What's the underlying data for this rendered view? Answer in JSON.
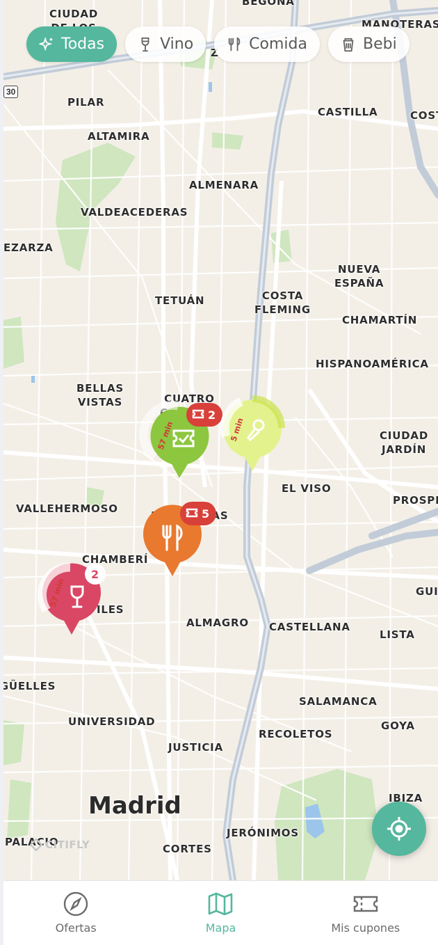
{
  "filters": [
    {
      "label": "Todas",
      "icon": "sparkles-icon",
      "active": true
    },
    {
      "label": "Vino",
      "icon": "wine-glass-icon",
      "active": false
    },
    {
      "label": "Comida",
      "icon": "fork-knife-icon",
      "active": false
    },
    {
      "label": "Bebi",
      "icon": "cup-icon",
      "active": false
    }
  ],
  "map": {
    "city": "Madrid",
    "road_shield": "30",
    "watermark": "CITIFLY",
    "places": [
      "CIUDAD\nDE LOS",
      "BEGOÑA",
      "MANOTERAS",
      "PILAR",
      "CASTILLA",
      "COST",
      "ALTAMIRA",
      "ALMENARA",
      "VALDEACEDERAS",
      "EZARZA",
      "NUEVA\nESPAÑA",
      "TETUÁN",
      "COSTA\nFLEMING",
      "CHAMARTÍN",
      "HISPANOAMÉRICA",
      "BELLAS\nVISTAS",
      "CUATRO\nCAMINOS",
      "CIUDAD\nJARDÍN",
      "EL VISO",
      "PROSPE",
      "VALLEHERMOSO",
      "RÍOS ROSAS",
      "CHAMBERÍ",
      "GUI",
      "ARAPILES",
      "ALMAGRO",
      "CASTELLANA",
      "LISTA",
      "ARGÜELLES",
      "SALAMANCA",
      "UNIVERSIDAD",
      "RECOLETOS",
      "GOYA",
      "JUSTICIA",
      "IBIZA",
      "PALACIO",
      "JERÓNIMOS",
      "CORTES",
      "Z"
    ]
  },
  "markers": [
    {
      "type": "coupon",
      "color": "#8dc63f",
      "minutes_label": "57 min",
      "badge_count": "2",
      "badge_color": "#d8403a",
      "icon": "ticket-check-icon"
    },
    {
      "type": "drink",
      "color": "#e4f28e",
      "minutes_label": "5 min",
      "icon": "microphone-icon"
    },
    {
      "type": "food",
      "color": "#e8792f",
      "badge_count": "5",
      "badge_color": "#d8403a",
      "icon": "fork-knife-icon"
    },
    {
      "type": "wine",
      "color": "#d94764",
      "minutes_label": "57 min",
      "badge_count": "2",
      "icon": "wine-glass-icon"
    }
  ],
  "nav": [
    {
      "label": "Ofertas",
      "icon": "compass-icon",
      "active": false
    },
    {
      "label": "Mapa",
      "icon": "map-icon",
      "active": true
    },
    {
      "label": "Mis cupones",
      "icon": "ticket-icon",
      "active": false
    }
  ],
  "colors": {
    "accent": "#55b79d",
    "map_bg": "#f3efe7",
    "park": "#cfe6bf",
    "highway": "#c5cfdb"
  }
}
